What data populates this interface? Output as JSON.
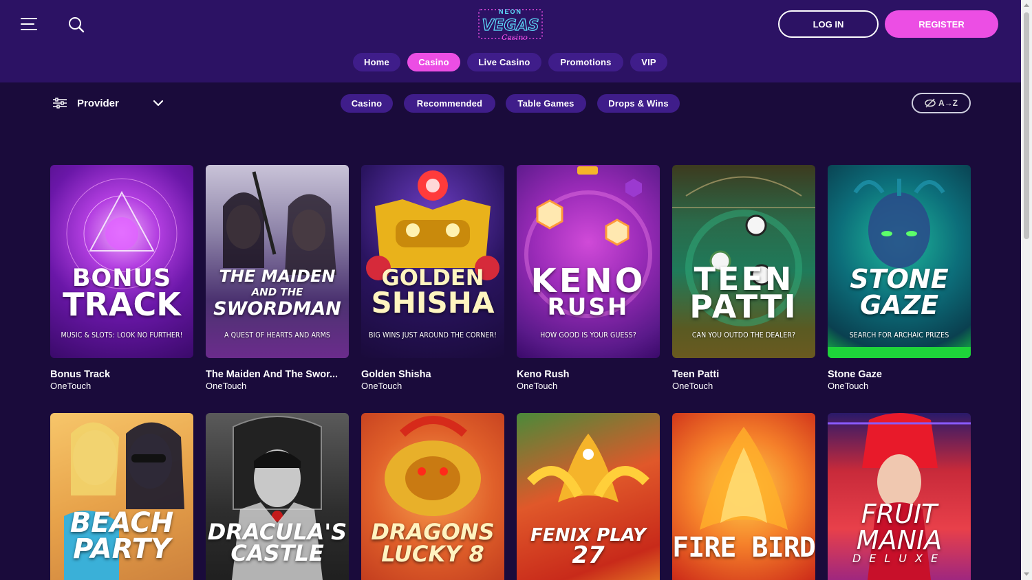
{
  "header": {
    "logo_top": "NEON",
    "logo_main": "VEGAS",
    "logo_sub": "Casino",
    "login_label": "LOG IN",
    "register_label": "REGISTER"
  },
  "nav": {
    "items": [
      {
        "label": "Home",
        "active": false
      },
      {
        "label": "Casino",
        "active": true
      },
      {
        "label": "Live Casino",
        "active": false
      },
      {
        "label": "Promotions",
        "active": false
      },
      {
        "label": "VIP",
        "active": false
      }
    ]
  },
  "filters": {
    "provider_label": "Provider",
    "categories": [
      "Casino",
      "Recommended",
      "Table Games",
      "Drops & Wins"
    ],
    "sort_label": "A→Z"
  },
  "games": [
    {
      "name": "Bonus Track",
      "provider": "OneTouch",
      "art_title_1": "BONUS",
      "art_title_2": "TRACK",
      "tagline": "MUSIC & SLOTS: LOOK NO FURTHER!"
    },
    {
      "name": "The Maiden And The Swor...",
      "provider": "OneTouch",
      "art_title_1": "THE MAIDEN",
      "art_title_mid": "AND THE",
      "art_title_2": "SWORDMAN",
      "tagline": "A QUEST OF HEARTS AND ARMS"
    },
    {
      "name": "Golden Shisha",
      "provider": "OneTouch",
      "art_title_1": "GOLDEN",
      "art_title_2": "SHISHA",
      "tagline": "BIG WINS JUST AROUND THE CORNER!"
    },
    {
      "name": "Keno Rush",
      "provider": "OneTouch",
      "art_title_1": "KENO",
      "art_title_2": "RUSH",
      "tagline": "HOW GOOD IS YOUR GUESS?"
    },
    {
      "name": "Teen Patti",
      "provider": "OneTouch",
      "art_title_1": "TEEN",
      "art_title_2": "PATTI",
      "tagline": "CAN YOU OUTDO THE DEALER?"
    },
    {
      "name": "Stone Gaze",
      "provider": "OneTouch",
      "art_title_1": "STONE",
      "art_title_2": "GAZE",
      "tagline": "SEARCH FOR ARCHAIC PRIZES"
    },
    {
      "art_title_1": "BEACH",
      "art_title_2": "PARTY"
    },
    {
      "art_title_1": "DRACULA'S",
      "art_title_2": "CASTLE"
    },
    {
      "art_title_1": "DRAGONS",
      "art_title_2": "LUCKY 8"
    },
    {
      "art_title_1": "FENIX PLAY",
      "art_title_2": "27"
    },
    {
      "art_title_1": "FIRE BIRD",
      "art_title_2": ""
    },
    {
      "art_title_1": "FRUIT",
      "art_title_2": "MANIA",
      "art_title_3": "DELUXE"
    }
  ],
  "colors": {
    "background": "#1a0b3b",
    "header": "#2c1264",
    "pill": "#3f1d8a",
    "accent": "#ec4ee4"
  }
}
